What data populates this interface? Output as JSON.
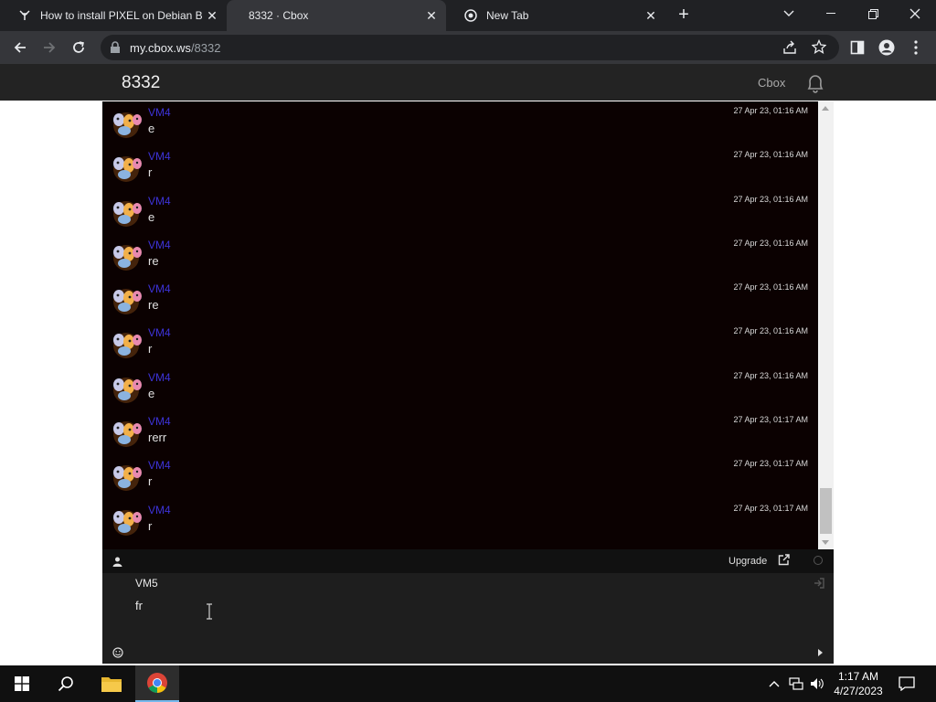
{
  "browser": {
    "tabs": [
      {
        "title": "How to install PIXEL on Debian B",
        "icon": "pixel-raspberry-icon"
      },
      {
        "title": "8332 · Cbox",
        "icon": "none"
      },
      {
        "title": "New Tab",
        "icon": "chrome-icon"
      }
    ],
    "url_host": "my.cbox.ws",
    "url_path": "/8332"
  },
  "cbox": {
    "title": "8332",
    "brand": "Cbox",
    "messages": [
      {
        "name": "VM4",
        "text": "e",
        "time": "27 Apr 23, 01:16 AM"
      },
      {
        "name": "VM4",
        "text": "r",
        "time": "27 Apr 23, 01:16 AM"
      },
      {
        "name": "VM4",
        "text": "e",
        "time": "27 Apr 23, 01:16 AM"
      },
      {
        "name": "VM4",
        "text": "re",
        "time": "27 Apr 23, 01:16 AM"
      },
      {
        "name": "VM4",
        "text": "re",
        "time": "27 Apr 23, 01:16 AM"
      },
      {
        "name": "VM4",
        "text": "r",
        "time": "27 Apr 23, 01:16 AM"
      },
      {
        "name": "VM4",
        "text": "e",
        "time": "27 Apr 23, 01:16 AM"
      },
      {
        "name": "VM4",
        "text": "rerr",
        "time": "27 Apr 23, 01:17 AM"
      },
      {
        "name": "VM4",
        "text": "r",
        "time": "27 Apr 23, 01:17 AM"
      },
      {
        "name": "VM4",
        "text": "r",
        "time": "27 Apr 23, 01:17 AM"
      }
    ],
    "footer": {
      "upgrade_label": "Upgrade"
    },
    "compose": {
      "username": "VM5",
      "input_value": "fr"
    }
  },
  "taskbar": {
    "time": "1:17 AM",
    "date": "4/27/2023"
  },
  "colors": {
    "chat_bg": "#0b0101",
    "username": "#3d33d8",
    "browser_dark": "#202124"
  }
}
